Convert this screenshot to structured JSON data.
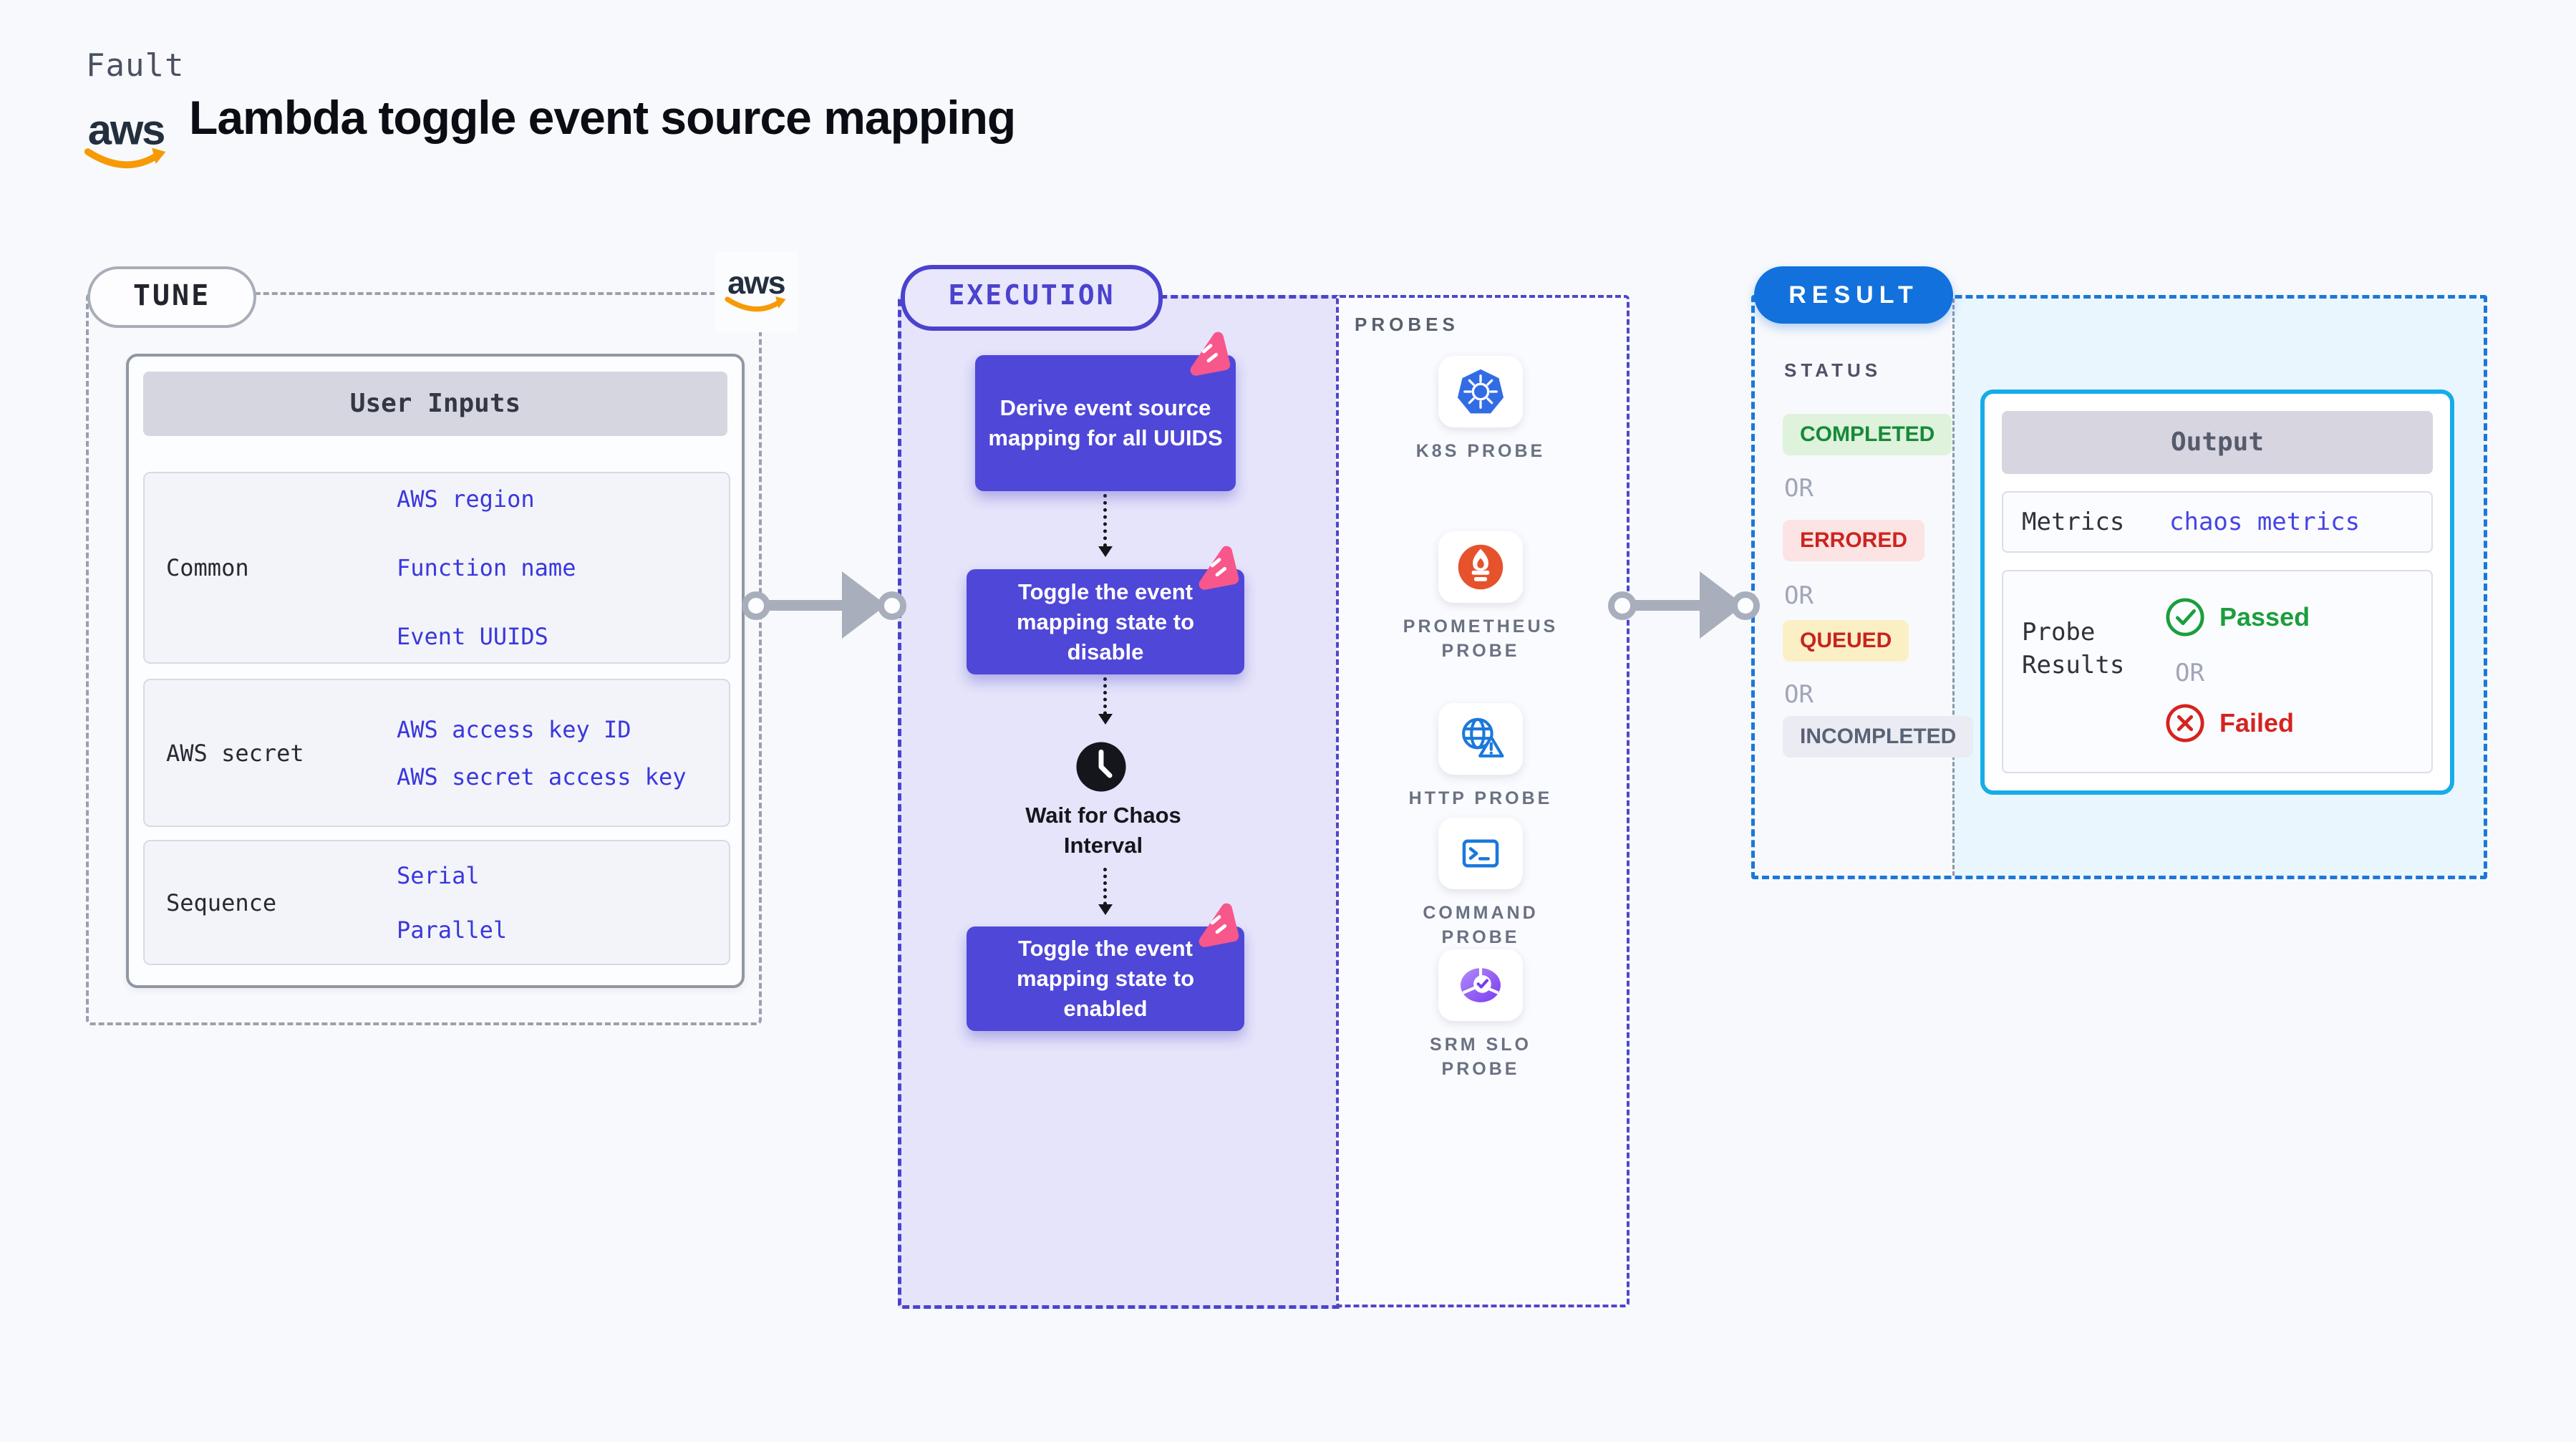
{
  "header": {
    "fault_label": "Fault",
    "title": "Lambda toggle event source mapping",
    "aws_text": "aws"
  },
  "tune": {
    "pill": "TUNE",
    "card_header": "User Inputs",
    "rows": [
      {
        "label": "Common",
        "values": [
          "AWS region",
          "Function name",
          "Event UUIDS"
        ]
      },
      {
        "label": "AWS secret",
        "values": [
          "AWS access key ID",
          "AWS secret access key"
        ]
      },
      {
        "label": "Sequence",
        "values": [
          "Serial",
          "Parallel"
        ]
      }
    ]
  },
  "execution": {
    "pill": "EXECUTION",
    "steps": [
      "Derive event source mapping for all UUIDS",
      "Toggle the event mapping state to disable",
      "Toggle the event mapping state to enabled"
    ],
    "wait_label": "Wait for Chaos Interval"
  },
  "probes": {
    "title": "PROBES",
    "items": [
      {
        "name": "K8S PROBE",
        "icon": "kubernetes-icon"
      },
      {
        "name": "PROMETHEUS PROBE",
        "icon": "prometheus-icon"
      },
      {
        "name": "HTTP PROBE",
        "icon": "http-globe-icon"
      },
      {
        "name": "COMMAND PROBE",
        "icon": "terminal-icon"
      },
      {
        "name": "SRM SLO PROBE",
        "icon": "srm-slo-icon"
      }
    ]
  },
  "result": {
    "pill": "RESULT",
    "status_label": "STATUS",
    "or_label": "OR",
    "statuses": [
      {
        "label": "COMPLETED",
        "bg": "#def2dc",
        "color": "#168a38"
      },
      {
        "label": "ERRORED",
        "bg": "#fbe4e3",
        "color": "#cc2420"
      },
      {
        "label": "QUEUED",
        "bg": "#fbf0c5",
        "color": "#c8241e"
      },
      {
        "label": "INCOMPLETED",
        "bg": "#ebecf3",
        "color": "#5a6276"
      }
    ],
    "output": {
      "header": "Output",
      "metrics_label": "Metrics",
      "metrics_value": "chaos metrics",
      "probe_results_label": "Probe Results",
      "passed_label": "Passed",
      "or_label": "OR",
      "failed_label": "Failed"
    }
  },
  "colors": {
    "page_bg": "#f8f9fc",
    "indigo_accent": "#4b42cd",
    "action_box": "#4f47d8",
    "link_blue": "#3a37de",
    "result_blue": "#1271dc",
    "output_border_cyan": "#17ace9",
    "cyan_bg": "#e9f6fd",
    "lavender_bg": "#e5e4fa",
    "fault_pink": "#f7578b",
    "aws_orange": "#f79a06",
    "aws_navy": "#232f3e",
    "passed_green": "#1b9e3d",
    "failed_red": "#d6231f"
  }
}
